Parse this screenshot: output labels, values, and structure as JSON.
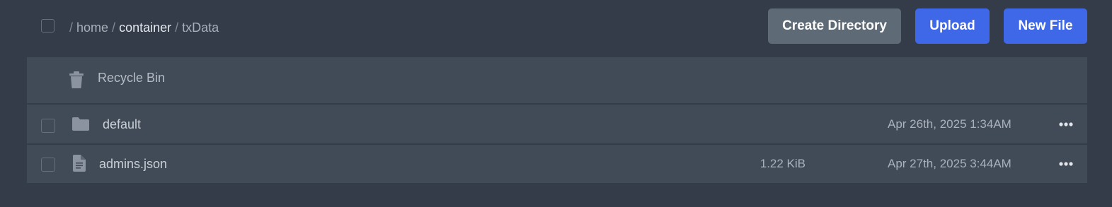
{
  "breadcrumb": {
    "separator": "/",
    "items": [
      "home",
      "container",
      "txData"
    ]
  },
  "toolbar": {
    "create_directory_label": "Create Directory",
    "upload_label": "Upload",
    "new_file_label": "New File"
  },
  "colors": {
    "background": "#333c48",
    "row": "#414b58",
    "primary_button": "#3e68e8",
    "secondary_button": "#5f6a77"
  },
  "recycle_bin": {
    "label": "Recycle Bin",
    "icon": "trash-icon"
  },
  "files": [
    {
      "name": "default",
      "type": "directory",
      "icon": "folder-icon",
      "size": "",
      "modified": "Apr 26th, 2025 1:34AM"
    },
    {
      "name": "admins.json",
      "type": "file",
      "icon": "file-icon",
      "size": "1.22 KiB",
      "modified": "Apr 27th, 2025 3:44AM"
    }
  ]
}
